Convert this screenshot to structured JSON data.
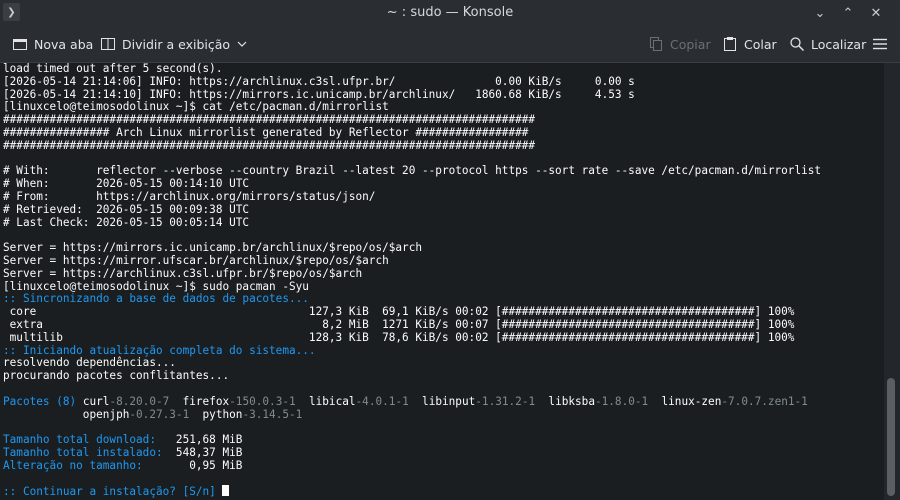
{
  "window": {
    "title": "~ : sudo — Konsole",
    "menu_icon": "chevron-right-icon",
    "controls": {
      "minimize": "⌄",
      "maximize": "⌃",
      "close": "✕"
    }
  },
  "toolbar": {
    "new_tab": "Nova aba",
    "split_view": "Dividir a exibição",
    "copy": "Copiar",
    "paste": "Colar",
    "find": "Localizar"
  },
  "terminal": {
    "lines": [
      [
        {
          "t": "load timed out after 5 second(s)."
        }
      ],
      [
        {
          "t": "[2026-05-14 21:14:06] INFO: https://archlinux.c3sl.ufpr.br/               0.00 KiB/s     0.00 s"
        }
      ],
      [
        {
          "t": "[2026-05-14 21:14:10] INFO: https://mirrors.ic.unicamp.br/archlinux/   1860.68 KiB/s     4.53 s"
        }
      ],
      [
        {
          "t": "[linuxcelo@teimosodolinux ~]$ cat /etc/pacman.d/mirrorlist"
        }
      ],
      [
        {
          "t": "################################################################################"
        }
      ],
      [
        {
          "t": "################ Arch Linux mirrorlist generated by Reflector #################"
        }
      ],
      [
        {
          "t": "################################################################################"
        }
      ],
      [
        {
          "t": ""
        }
      ],
      [
        {
          "t": "# With:       reflector --verbose --country Brazil --latest 20 --protocol https --sort rate --save /etc/pacman.d/mirrorlist"
        }
      ],
      [
        {
          "t": "# When:       2026-05-15 00:14:10 UTC"
        }
      ],
      [
        {
          "t": "# From:       https://archlinux.org/mirrors/status/json/"
        }
      ],
      [
        {
          "t": "# Retrieved:  2026-05-15 00:09:38 UTC"
        }
      ],
      [
        {
          "t": "# Last Check: 2026-05-15 00:05:14 UTC"
        }
      ],
      [
        {
          "t": ""
        }
      ],
      [
        {
          "t": "Server = https://mirrors.ic.unicamp.br/archlinux/$repo/os/$arch"
        }
      ],
      [
        {
          "t": "Server = https://mirror.ufscar.br/archlinux/$repo/os/$arch"
        }
      ],
      [
        {
          "t": "Server = https://archlinux.c3sl.ufpr.br/$repo/os/$arch"
        }
      ],
      [
        {
          "t": "[linuxcelo@teimosodolinux ~]$ sudo pacman -Syu"
        }
      ],
      [
        {
          "t": ":: Sincronizando a base de dados de pacotes...",
          "c": "c"
        }
      ],
      [
        {
          "t": " core                                         127,3 KiB  69,1 KiB/s 00:02 [######################################] 100%"
        }
      ],
      [
        {
          "t": " extra                                          8,2 MiB  1271 KiB/s 00:07 [######################################] 100%"
        }
      ],
      [
        {
          "t": " multilib                                     128,3 KiB  78,6 KiB/s 00:02 [######################################] 100%"
        }
      ],
      [
        {
          "t": ":: Iniciando atualização completa do sistema...",
          "c": "c"
        }
      ],
      [
        {
          "t": "resolvendo dependências..."
        }
      ],
      [
        {
          "t": "procurando pacotes conflitantes..."
        }
      ],
      [
        {
          "t": ""
        }
      ],
      [
        {
          "t": "Pacotes (8)",
          "c": "c"
        },
        {
          "t": " curl"
        },
        {
          "t": "-8.20.0-7",
          "c": "dim"
        },
        {
          "t": "  firefox"
        },
        {
          "t": "-150.0.3-1",
          "c": "dim"
        },
        {
          "t": "  libical"
        },
        {
          "t": "-4.0.1-1",
          "c": "dim"
        },
        {
          "t": "  libinput"
        },
        {
          "t": "-1.31.2-1",
          "c": "dim"
        },
        {
          "t": "  libksba"
        },
        {
          "t": "-1.8.0-1",
          "c": "dim"
        },
        {
          "t": "  linux-zen"
        },
        {
          "t": "-7.0.7.zen1-1",
          "c": "dim"
        }
      ],
      [
        {
          "t": "            openjph"
        },
        {
          "t": "-0.27.3-1",
          "c": "dim"
        },
        {
          "t": "  python"
        },
        {
          "t": "-3.14.5-1",
          "c": "dim"
        }
      ],
      [
        {
          "t": ""
        }
      ],
      [
        {
          "t": "Tamanho total download:",
          "c": "c"
        },
        {
          "t": "   251,68 MiB"
        }
      ],
      [
        {
          "t": "Tamanho total instalado:",
          "c": "c"
        },
        {
          "t": "  548,37 MiB"
        }
      ],
      [
        {
          "t": "Alteração no tamanho:",
          "c": "c"
        },
        {
          "t": "       0,95 MiB"
        }
      ],
      [
        {
          "t": ""
        }
      ],
      [
        {
          "t": ":: Continuar a instalação? [S/n] ",
          "c": "c"
        },
        {
          "cursor": true
        }
      ]
    ]
  },
  "colors": {
    "background": "#1b1e20",
    "accent": "#1d99f3",
    "dim": "#7f8c8d"
  }
}
